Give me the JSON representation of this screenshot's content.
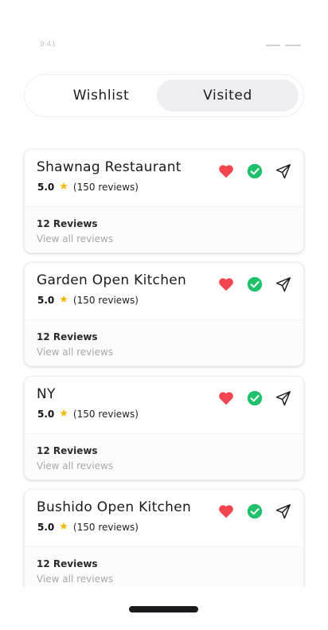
{
  "status_bar": {
    "time": "9:41"
  },
  "tabs": [
    {
      "label": "Wishlist",
      "active": false
    },
    {
      "label": "Visited",
      "active": true
    }
  ],
  "colors": {
    "heart": "#f2454f",
    "check": "#1fc16b",
    "star": "#f5b800",
    "tab_active_bg": "#eeeef2"
  },
  "icons": {
    "like": "heart-icon",
    "visited": "check-circle-icon",
    "share": "send-icon",
    "rating": "star-icon"
  },
  "restaurants": [
    {
      "name": "Shawnag Restaurant",
      "rating": "5.0",
      "rating_count": "(150 reviews)",
      "reviews_count": "12 Reviews",
      "reviews_link": "View all reviews"
    },
    {
      "name": "Garden Open Kitchen",
      "rating": "5.0",
      "rating_count": "(150 reviews)",
      "reviews_count": "12 Reviews",
      "reviews_link": "View all reviews"
    },
    {
      "name": "NY",
      "rating": "5.0",
      "rating_count": "(150 reviews)",
      "reviews_count": "12 Reviews",
      "reviews_link": "View all reviews"
    },
    {
      "name": "Bushido Open Kitchen",
      "rating": "5.0",
      "rating_count": "(150 reviews)",
      "reviews_count": "12 Reviews",
      "reviews_link": "View all reviews"
    }
  ]
}
